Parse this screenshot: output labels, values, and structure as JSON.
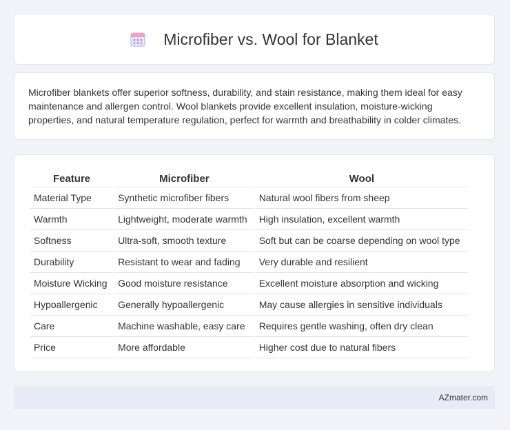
{
  "header": {
    "icon": "calendar-icon",
    "title": "Microfiber vs. Wool for Blanket"
  },
  "summary": {
    "text": "Microfiber blankets offer superior softness, durability, and stain resistance, making them ideal for easy maintenance and allergen control. Wool blankets provide excellent insulation, moisture-wicking properties, and natural temperature regulation, perfect for warmth and breathability in colder climates."
  },
  "table": {
    "headers": [
      "Feature",
      "Microfiber",
      "Wool"
    ],
    "rows": [
      [
        "Material Type",
        "Synthetic microfiber fibers",
        "Natural wool fibers from sheep"
      ],
      [
        "Warmth",
        "Lightweight, moderate warmth",
        "High insulation, excellent warmth"
      ],
      [
        "Softness",
        "Ultra-soft, smooth texture",
        "Soft but can be coarse depending on wool type"
      ],
      [
        "Durability",
        "Resistant to wear and fading",
        "Very durable and resilient"
      ],
      [
        "Moisture Wicking",
        "Good moisture resistance",
        "Excellent moisture absorption and wicking"
      ],
      [
        "Hypoallergenic",
        "Generally hypoallergenic",
        "May cause allergies in sensitive individuals"
      ],
      [
        "Care",
        "Machine washable, easy care",
        "Requires gentle washing, often dry clean"
      ],
      [
        "Price",
        "More affordable",
        "Higher cost due to natural fibers"
      ]
    ]
  },
  "footer": {
    "site": "AZmater.com"
  },
  "colors": {
    "background": "#f1f3f8",
    "card": "#ffffff",
    "footer": "#e6ebf6",
    "icon_accent": "#8e7ce8"
  }
}
